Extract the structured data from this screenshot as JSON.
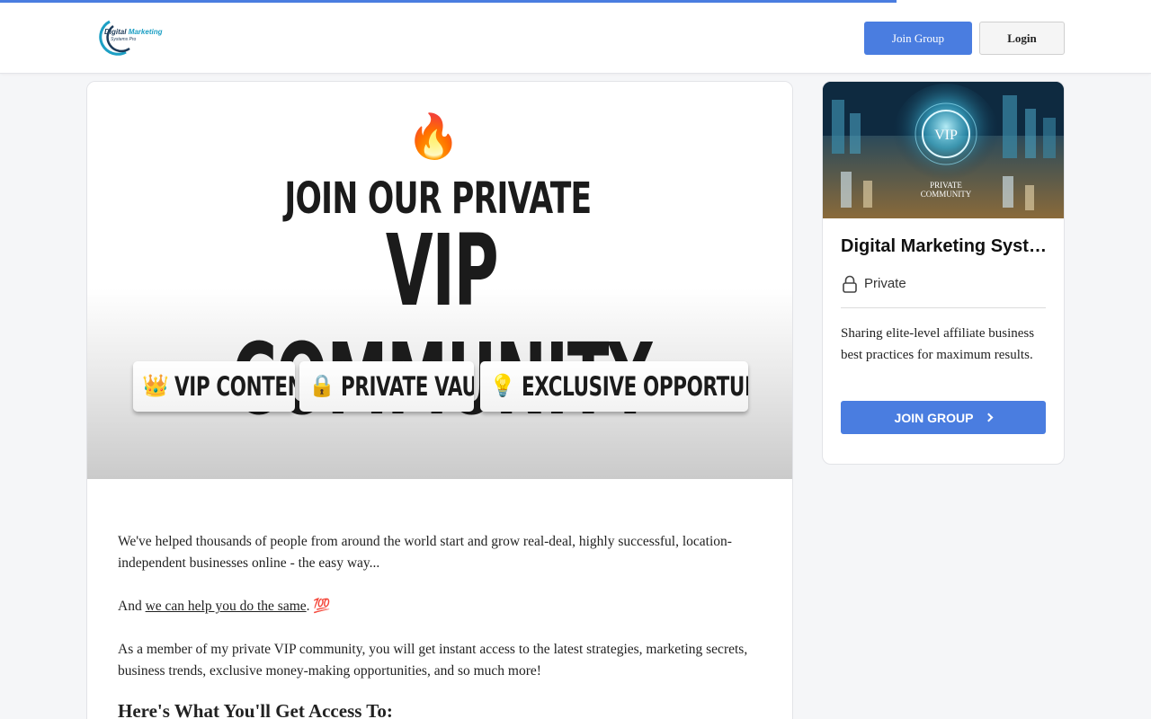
{
  "header": {
    "logo": {
      "line1_word1": "Digital",
      "line1_word2": "Marketing",
      "line2": "Systems Pro"
    },
    "join_label": "Join Group",
    "login_label": "Login"
  },
  "hero": {
    "icon": "fire-emoji",
    "fire_glyph": "🔥",
    "line1": "JOIN OUR PRIVATE",
    "line2": "VIP COMMUNITY",
    "pills": [
      {
        "icon": "crown-icon",
        "glyph": "👑",
        "label": "VIP CONTENT"
      },
      {
        "icon": "vault-icon",
        "glyph": "🔒",
        "label": "PRIVATE VAULT"
      },
      {
        "icon": "lightbulb-icon",
        "glyph": "💡",
        "label": "EXCLUSIVE OPPORTUNITIES"
      }
    ]
  },
  "body": {
    "p1": "We've helped thousands of people from around the world start and grow real-deal, highly successful, location-independent businesses online - the easy way...",
    "p2_prefix": "And ",
    "p2_link": "we can help you do the same",
    "p2_suffix": ". ",
    "p2_emoji": "💯",
    "p3": "As a member of my private VIP community, you will get instant access to the latest strategies, marketing secrets, business trends, exclusive money-making opportunities, and so much more!",
    "heading": "Here's What You'll Get Access To:"
  },
  "sidebar": {
    "image_text": {
      "badge": "VIP",
      "caption1": "PRIVATE",
      "caption2": "COMMUNITY"
    },
    "title": "Digital Marketing Systems Pro",
    "privacy": "Private",
    "description": "Sharing elite-level affiliate business best practices for maximum results.",
    "join_label": "JOIN GROUP"
  },
  "colors": {
    "accent": "#4a7de0",
    "background": "#f5f6f8"
  }
}
